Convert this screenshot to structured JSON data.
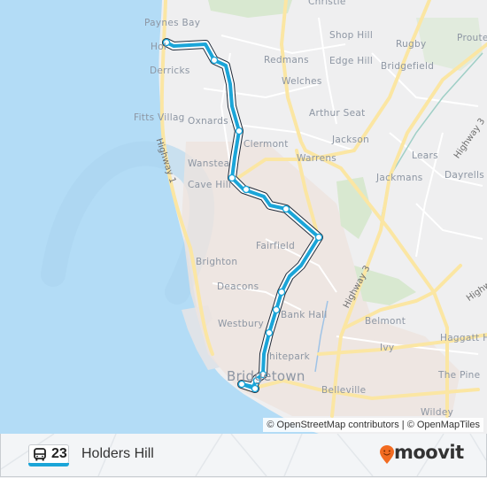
{
  "map": {
    "places": [
      {
        "name": "Christie",
        "size": "normal"
      },
      {
        "name": "Paynes Bay",
        "size": "normal"
      },
      {
        "name": "Shop Hill",
        "size": "normal"
      },
      {
        "name": "Rugby",
        "size": "normal"
      },
      {
        "name": "Proute",
        "size": "normal"
      },
      {
        "name": "Hol",
        "size": "normal"
      },
      {
        "name": "Redmans",
        "size": "normal"
      },
      {
        "name": "Edge Hill",
        "size": "normal"
      },
      {
        "name": "Bridgefield",
        "size": "normal"
      },
      {
        "name": "Derricks",
        "size": "normal"
      },
      {
        "name": "Welches",
        "size": "normal"
      },
      {
        "name": "Arthur Seat",
        "size": "normal"
      },
      {
        "name": "Fitts Villag",
        "size": "normal"
      },
      {
        "name": "Oxnards",
        "size": "normal"
      },
      {
        "name": "Clermont",
        "size": "normal"
      },
      {
        "name": "Jackson",
        "size": "normal"
      },
      {
        "name": "Lears",
        "size": "normal"
      },
      {
        "name": "Warrens",
        "size": "normal"
      },
      {
        "name": "Wanstea",
        "size": "normal"
      },
      {
        "name": "Cave Hill",
        "size": "normal"
      },
      {
        "name": "Jackmans",
        "size": "normal"
      },
      {
        "name": "Dayrells",
        "size": "normal"
      },
      {
        "name": "Fairfield",
        "size": "normal"
      },
      {
        "name": "Brighton",
        "size": "normal"
      },
      {
        "name": "Deacons",
        "size": "normal"
      },
      {
        "name": "Bank Hall",
        "size": "normal"
      },
      {
        "name": "Belmont",
        "size": "normal"
      },
      {
        "name": "Westbury",
        "size": "normal"
      },
      {
        "name": "Haggatt H",
        "size": "normal"
      },
      {
        "name": "Ivy",
        "size": "normal"
      },
      {
        "name": "hitepark",
        "size": "normal"
      },
      {
        "name": "The Pine",
        "size": "normal"
      },
      {
        "name": "Bridgetown",
        "size": "big"
      },
      {
        "name": "Belleville",
        "size": "normal"
      },
      {
        "name": "Wildey",
        "size": "normal"
      }
    ],
    "highways": [
      {
        "name": "Highway 1"
      },
      {
        "name": "Highway 3"
      },
      {
        "name": "Highway 3 "
      },
      {
        "name": "Highw"
      }
    ],
    "route": {
      "color": "#1ba5d8",
      "stop_count": 14
    },
    "attribution": "© OpenStreetMap contributors | © OpenMapTiles"
  },
  "footer": {
    "route_number": "23",
    "destination": "Holders Hill",
    "mode_icon": "bus-icon",
    "brand": "moovit",
    "brand_color": "#f26b21",
    "accent_color": "#1ba5d8"
  }
}
